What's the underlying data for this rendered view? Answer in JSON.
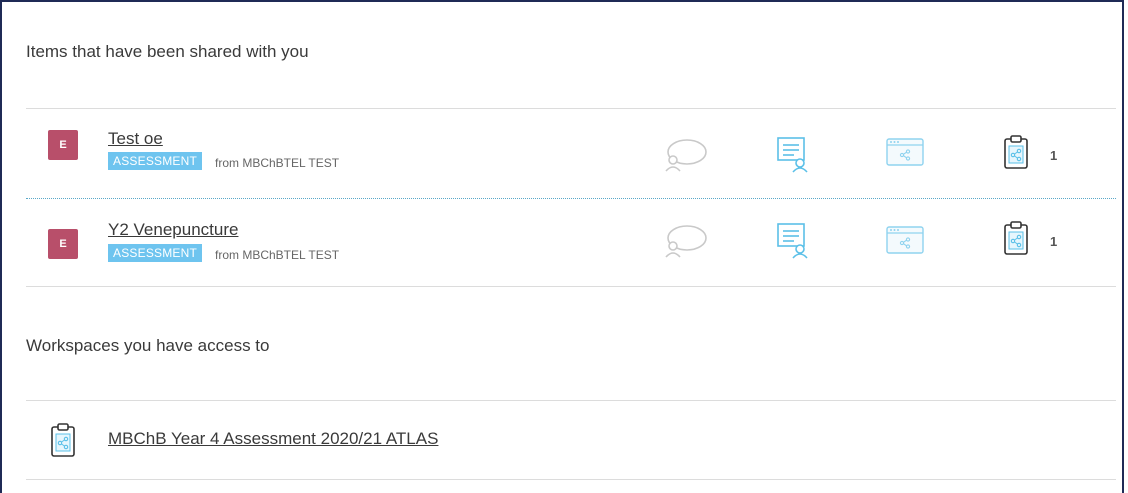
{
  "shared": {
    "heading": "Items that have been shared with you",
    "items": [
      {
        "initial": "E",
        "title": "Test oe",
        "badge": "ASSESSMENT",
        "from": "from MBChBTEL TEST",
        "count": "1"
      },
      {
        "initial": "E",
        "title": "Y2 Venepuncture",
        "badge": "ASSESSMENT",
        "from": "from MBChBTEL TEST",
        "count": "1"
      }
    ]
  },
  "workspaces": {
    "heading": "Workspaces you have access to",
    "items": [
      {
        "title": "MBChB Year 4 Assessment 2020/21 ATLAS"
      }
    ]
  },
  "colors": {
    "frame": "#1f2a56",
    "avatar": "#b84f6a",
    "badge": "#6ec4ef",
    "icon_accent": "#5bc0e8"
  }
}
